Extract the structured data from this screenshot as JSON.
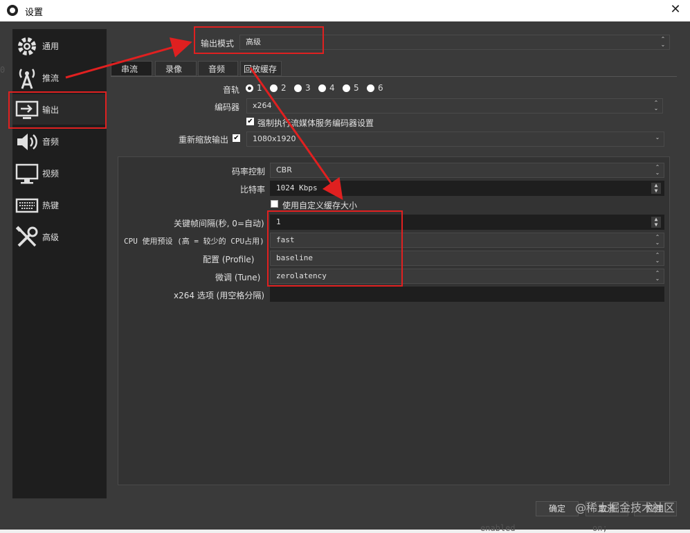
{
  "window": {
    "title": "设置",
    "close": "✕"
  },
  "sidebar": {
    "items": [
      {
        "label": "通用",
        "icon": "gear-icon"
      },
      {
        "label": "推流",
        "icon": "antenna-icon"
      },
      {
        "label": "输出",
        "icon": "output-icon"
      },
      {
        "label": "音频",
        "icon": "speaker-icon"
      },
      {
        "label": "视频",
        "icon": "monitor-icon"
      },
      {
        "label": "热键",
        "icon": "keyboard-icon"
      },
      {
        "label": "高级",
        "icon": "tools-icon"
      }
    ],
    "active": "输出"
  },
  "output_mode": {
    "label": "输出模式",
    "value": "高级"
  },
  "tabs": [
    "串流",
    "录像",
    "音频",
    "回放缓存"
  ],
  "active_tab": "串流",
  "streaming": {
    "audio_track_label": "音轨",
    "audio_tracks": [
      "1",
      "2",
      "3",
      "4",
      "5",
      "6"
    ],
    "selected_track": "1",
    "encoder_label": "编码器",
    "encoder_value": "x264",
    "enforce_label": "强制执行流媒体服务编码器设置",
    "enforce_checked": true,
    "rescale_label": "重新缩放输出",
    "rescale_checked": true,
    "rescale_value": "1080x1920"
  },
  "encoder_settings": {
    "rate_control_label": "码率控制",
    "rate_control_value": "CBR",
    "bitrate_label": "比特率",
    "bitrate_value": "1024 Kbps",
    "custom_buffer_label": "使用自定义缓存大小",
    "custom_buffer_checked": false,
    "keyframe_label": "关键帧间隔(秒, 0=自动)",
    "keyframe_value": "1",
    "cpu_preset_label": "CPU 使用预设 (高 = 较少的 CPU占用)",
    "cpu_preset_value": "fast",
    "profile_label": "配置 (Profile)",
    "profile_value": "baseline",
    "tune_label": "微调 (Tune)",
    "tune_value": "zerolatency",
    "x264_options_label": "x264 选项 (用空格分隔)",
    "x264_options_value": ""
  },
  "buttons": {
    "ok": "确定",
    "cancel": "取消",
    "apply": "应用"
  },
  "watermark": "@稀土掘金技术社区",
  "background_fragments": {
    "left_edge_char": "0",
    "bottom_text": "enabled",
    "bottom_right_text": "on;"
  },
  "colors": {
    "annotation": "#e02020",
    "window_bg": "#3a3a3a",
    "sidebar_bg": "#1e1e1e"
  }
}
